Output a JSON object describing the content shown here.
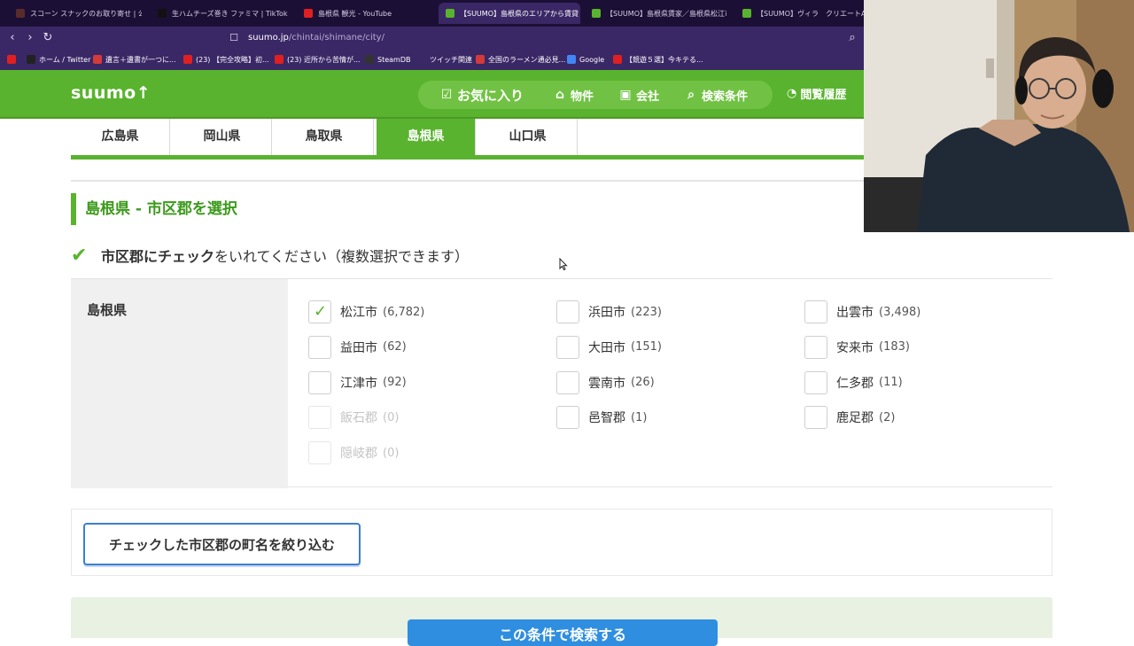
{
  "browser": {
    "tabs": [
      {
        "label": "スコーン スナックのお取り寄せ | 公式通販",
        "fav": "#5a2b2b"
      },
      {
        "label": "生ハムチーズ巻き ファミマ | TikTok",
        "fav": "#111111"
      },
      {
        "label": "島根県 観光 - YouTube",
        "fav": "#e02020"
      },
      {
        "label": "【SUUMO】島根県のエリアから賃貸",
        "fav": "#59b32e",
        "active": true
      },
      {
        "label": "【SUUMO】島根県賃家／島根県松江市...",
        "fav": "#59b32e"
      },
      {
        "label": "【SUUMO】ヴィラ　クリエートA／島根県...",
        "fav": "#59b32e"
      }
    ],
    "tab_close": "×",
    "nav": {
      "back": "‹",
      "forward": "›",
      "reload": "↻",
      "bookmark": "☐",
      "zoom": "⌕"
    },
    "url_host": "suumo.jp",
    "url_path": "/chintai/shimane/city/",
    "bookmarks": [
      {
        "label": "",
        "color": "#e02020"
      },
      {
        "label": "ホーム / Twitter",
        "color": "#222222"
      },
      {
        "label": "遺言＋遺書が一つに...",
        "color": "#d33a3a"
      },
      {
        "label": "(23) 【完全攻略】初...",
        "color": "#e02020"
      },
      {
        "label": "(23) 近所から苦情が...",
        "color": "#e02020"
      },
      {
        "label": "SteamDB",
        "color": "#333333"
      },
      {
        "label": "ツイッチ関連",
        "color": "#3a2766"
      },
      {
        "label": "全国のラーメン通必見...",
        "color": "#d33a3a"
      },
      {
        "label": "Google",
        "color": "#4285f4"
      },
      {
        "label": "【競遊５選】今キテる...",
        "color": "#e02020"
      }
    ]
  },
  "site": {
    "logo": "suumo↑",
    "menu": {
      "favorites": "お気に入り",
      "properties": "物件",
      "company": "会社",
      "search_conditions": "検索条件",
      "history": "閲覧履歴"
    }
  },
  "prefecture_tabs": [
    "広島県",
    "岡山県",
    "鳥取県",
    "島根県",
    "山口県"
  ],
  "active_prefecture_index": 3,
  "section_title": "島根県 - 市区郡を選択",
  "instruction": {
    "bold": "市区郡にチェック",
    "rest": "をいれてください（複数選択できます）"
  },
  "panel": {
    "prefecture": "島根県",
    "cities": [
      {
        "name": "松江市",
        "count": "(6,782)",
        "checked": true,
        "disabled": false
      },
      {
        "name": "浜田市",
        "count": "(223)",
        "checked": false,
        "disabled": false
      },
      {
        "name": "出雲市",
        "count": "(3,498)",
        "checked": false,
        "disabled": false
      },
      {
        "name": "益田市",
        "count": "(62)",
        "checked": false,
        "disabled": false
      },
      {
        "name": "大田市",
        "count": "(151)",
        "checked": false,
        "disabled": false
      },
      {
        "name": "安来市",
        "count": "(183)",
        "checked": false,
        "disabled": false
      },
      {
        "name": "江津市",
        "count": "(92)",
        "checked": false,
        "disabled": false
      },
      {
        "name": "雲南市",
        "count": "(26)",
        "checked": false,
        "disabled": false
      },
      {
        "name": "仁多郡",
        "count": "(11)",
        "checked": false,
        "disabled": false
      },
      {
        "name": "飯石郡",
        "count": "(0)",
        "checked": false,
        "disabled": true
      },
      {
        "name": "邑智郡",
        "count": "(1)",
        "checked": false,
        "disabled": false
      },
      {
        "name": "鹿足郡",
        "count": "(2)",
        "checked": false,
        "disabled": false
      },
      {
        "name": "隠岐郡",
        "count": "(0)",
        "checked": false,
        "disabled": true
      }
    ],
    "check_mark": "✓"
  },
  "filter_button": "チェックした市区郡の町名を絞り込む",
  "search_button": "この条件で検索する",
  "colors": {
    "brand_green": "#59b32e",
    "browser_bg": "#3a2766",
    "button_blue": "#2f8ee0"
  }
}
